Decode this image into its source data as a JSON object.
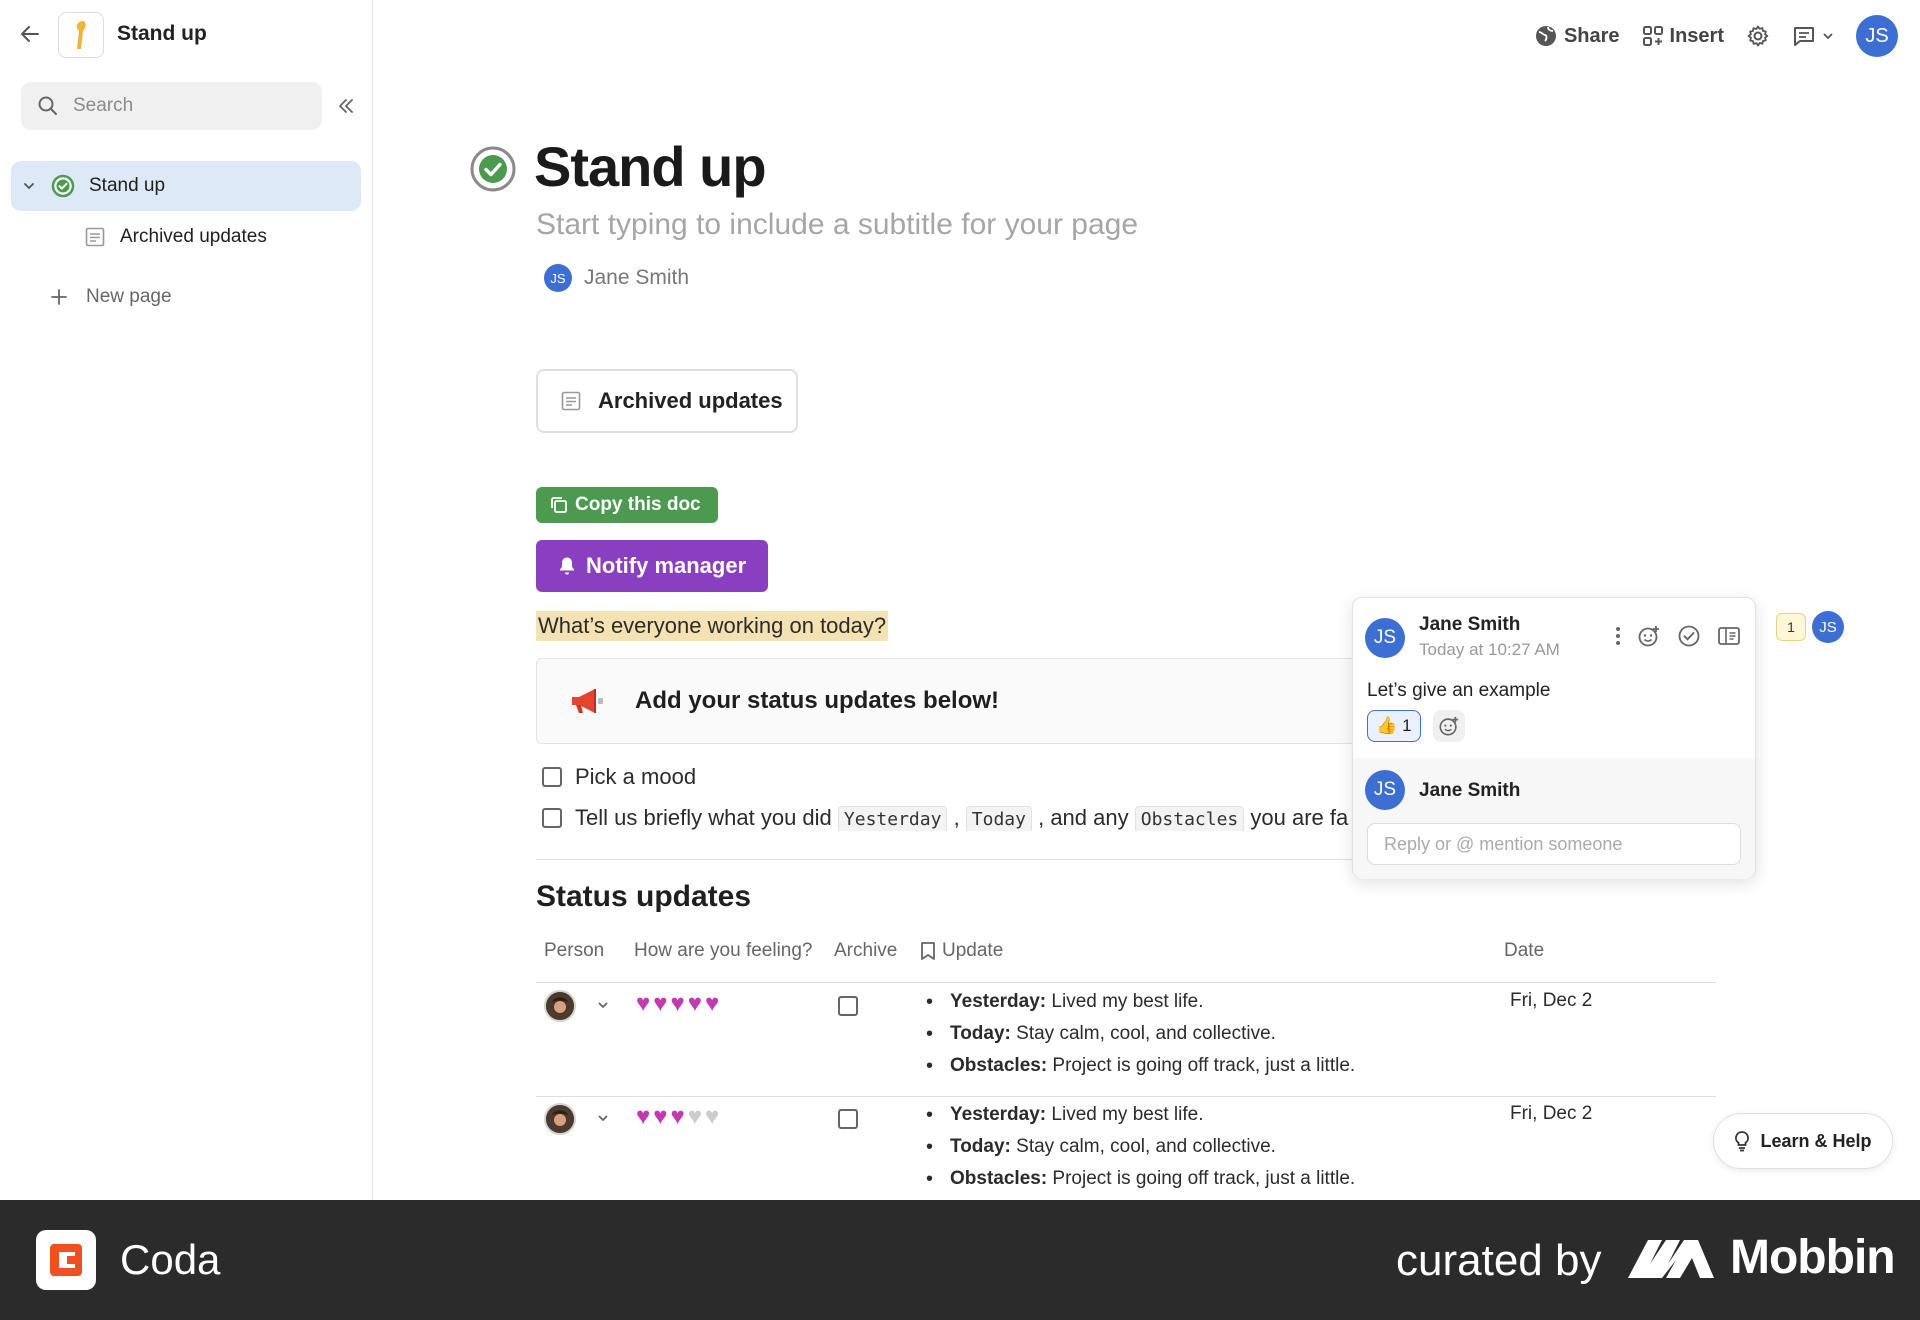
{
  "doc": {
    "title": "Stand up"
  },
  "sidebar": {
    "search_placeholder": "Search",
    "items": [
      {
        "label": "Stand up"
      },
      {
        "label": "Archived updates"
      }
    ],
    "new_page_label": "New page"
  },
  "toolbar": {
    "share_label": "Share",
    "insert_label": "Insert",
    "avatar_initials": "JS"
  },
  "page": {
    "title": "Stand up",
    "subtitle_placeholder": "Start typing to include a subtitle for your page",
    "author": {
      "initials": "JS",
      "name": "Jane Smith"
    },
    "archived_card_label": "Archived updates",
    "copy_button": "Copy this doc",
    "notify_button": "Notify manager",
    "highlight_text": "What’s everyone working on today?",
    "callout_text": "Add your status updates below!",
    "todo1": "Pick a mood",
    "todo2": {
      "prefix": "Tell us briefly what you did ",
      "code1": "Yesterday",
      "sep1": " , ",
      "code2": "Today",
      "mid": " , and any ",
      "code3": "Obstacles",
      "suffix": " you are fa"
    },
    "section_heading": "Status updates"
  },
  "table": {
    "headers": {
      "person": "Person",
      "feeling": "How are you feeling?",
      "archive": "Archive",
      "update": "Update",
      "date": "Date"
    },
    "rows": [
      {
        "hearts_filled": 5,
        "yesterday_label": "Yesterday:",
        "yesterday": " Lived my best life.",
        "today_label": "Today:",
        "today": " Stay calm, cool, and collective.",
        "obstacles_label": "Obstacles:",
        "obstacles": " Project is going off track, just a little.",
        "date": "Fri, Dec 2"
      },
      {
        "hearts_filled": 3,
        "yesterday_label": "Yesterday:",
        "yesterday": " Lived my best life.",
        "today_label": "Today:",
        "today": " Stay calm, cool, and collective.",
        "obstacles_label": "Obstacles:",
        "obstacles": " Project is going off track, just a little.",
        "date": "Fri, Dec 2"
      }
    ]
  },
  "comment": {
    "author_initials": "JS",
    "author": "Jane Smith",
    "time": "Today at 10:27 AM",
    "body": "Let’s give an example",
    "reaction_emoji": "👍",
    "reaction_count": "1",
    "reply_author": "Jane Smith",
    "reply_placeholder": "Reply or @ mention someone",
    "marker_count": "1"
  },
  "learn_help_label": "Learn & Help",
  "footer": {
    "app_name": "Coda",
    "curated_by": "curated by",
    "brand": "Mobbin"
  },
  "colors": {
    "accent_blue": "#3d6fd3",
    "copy_green": "#4b9a50",
    "notify_purple": "#8a3fc1",
    "heart_pink": "#c33ab0",
    "highlight": "#f4e2b2",
    "footer_bg": "#2b2b2b",
    "coda_orange": "#f04e23"
  }
}
